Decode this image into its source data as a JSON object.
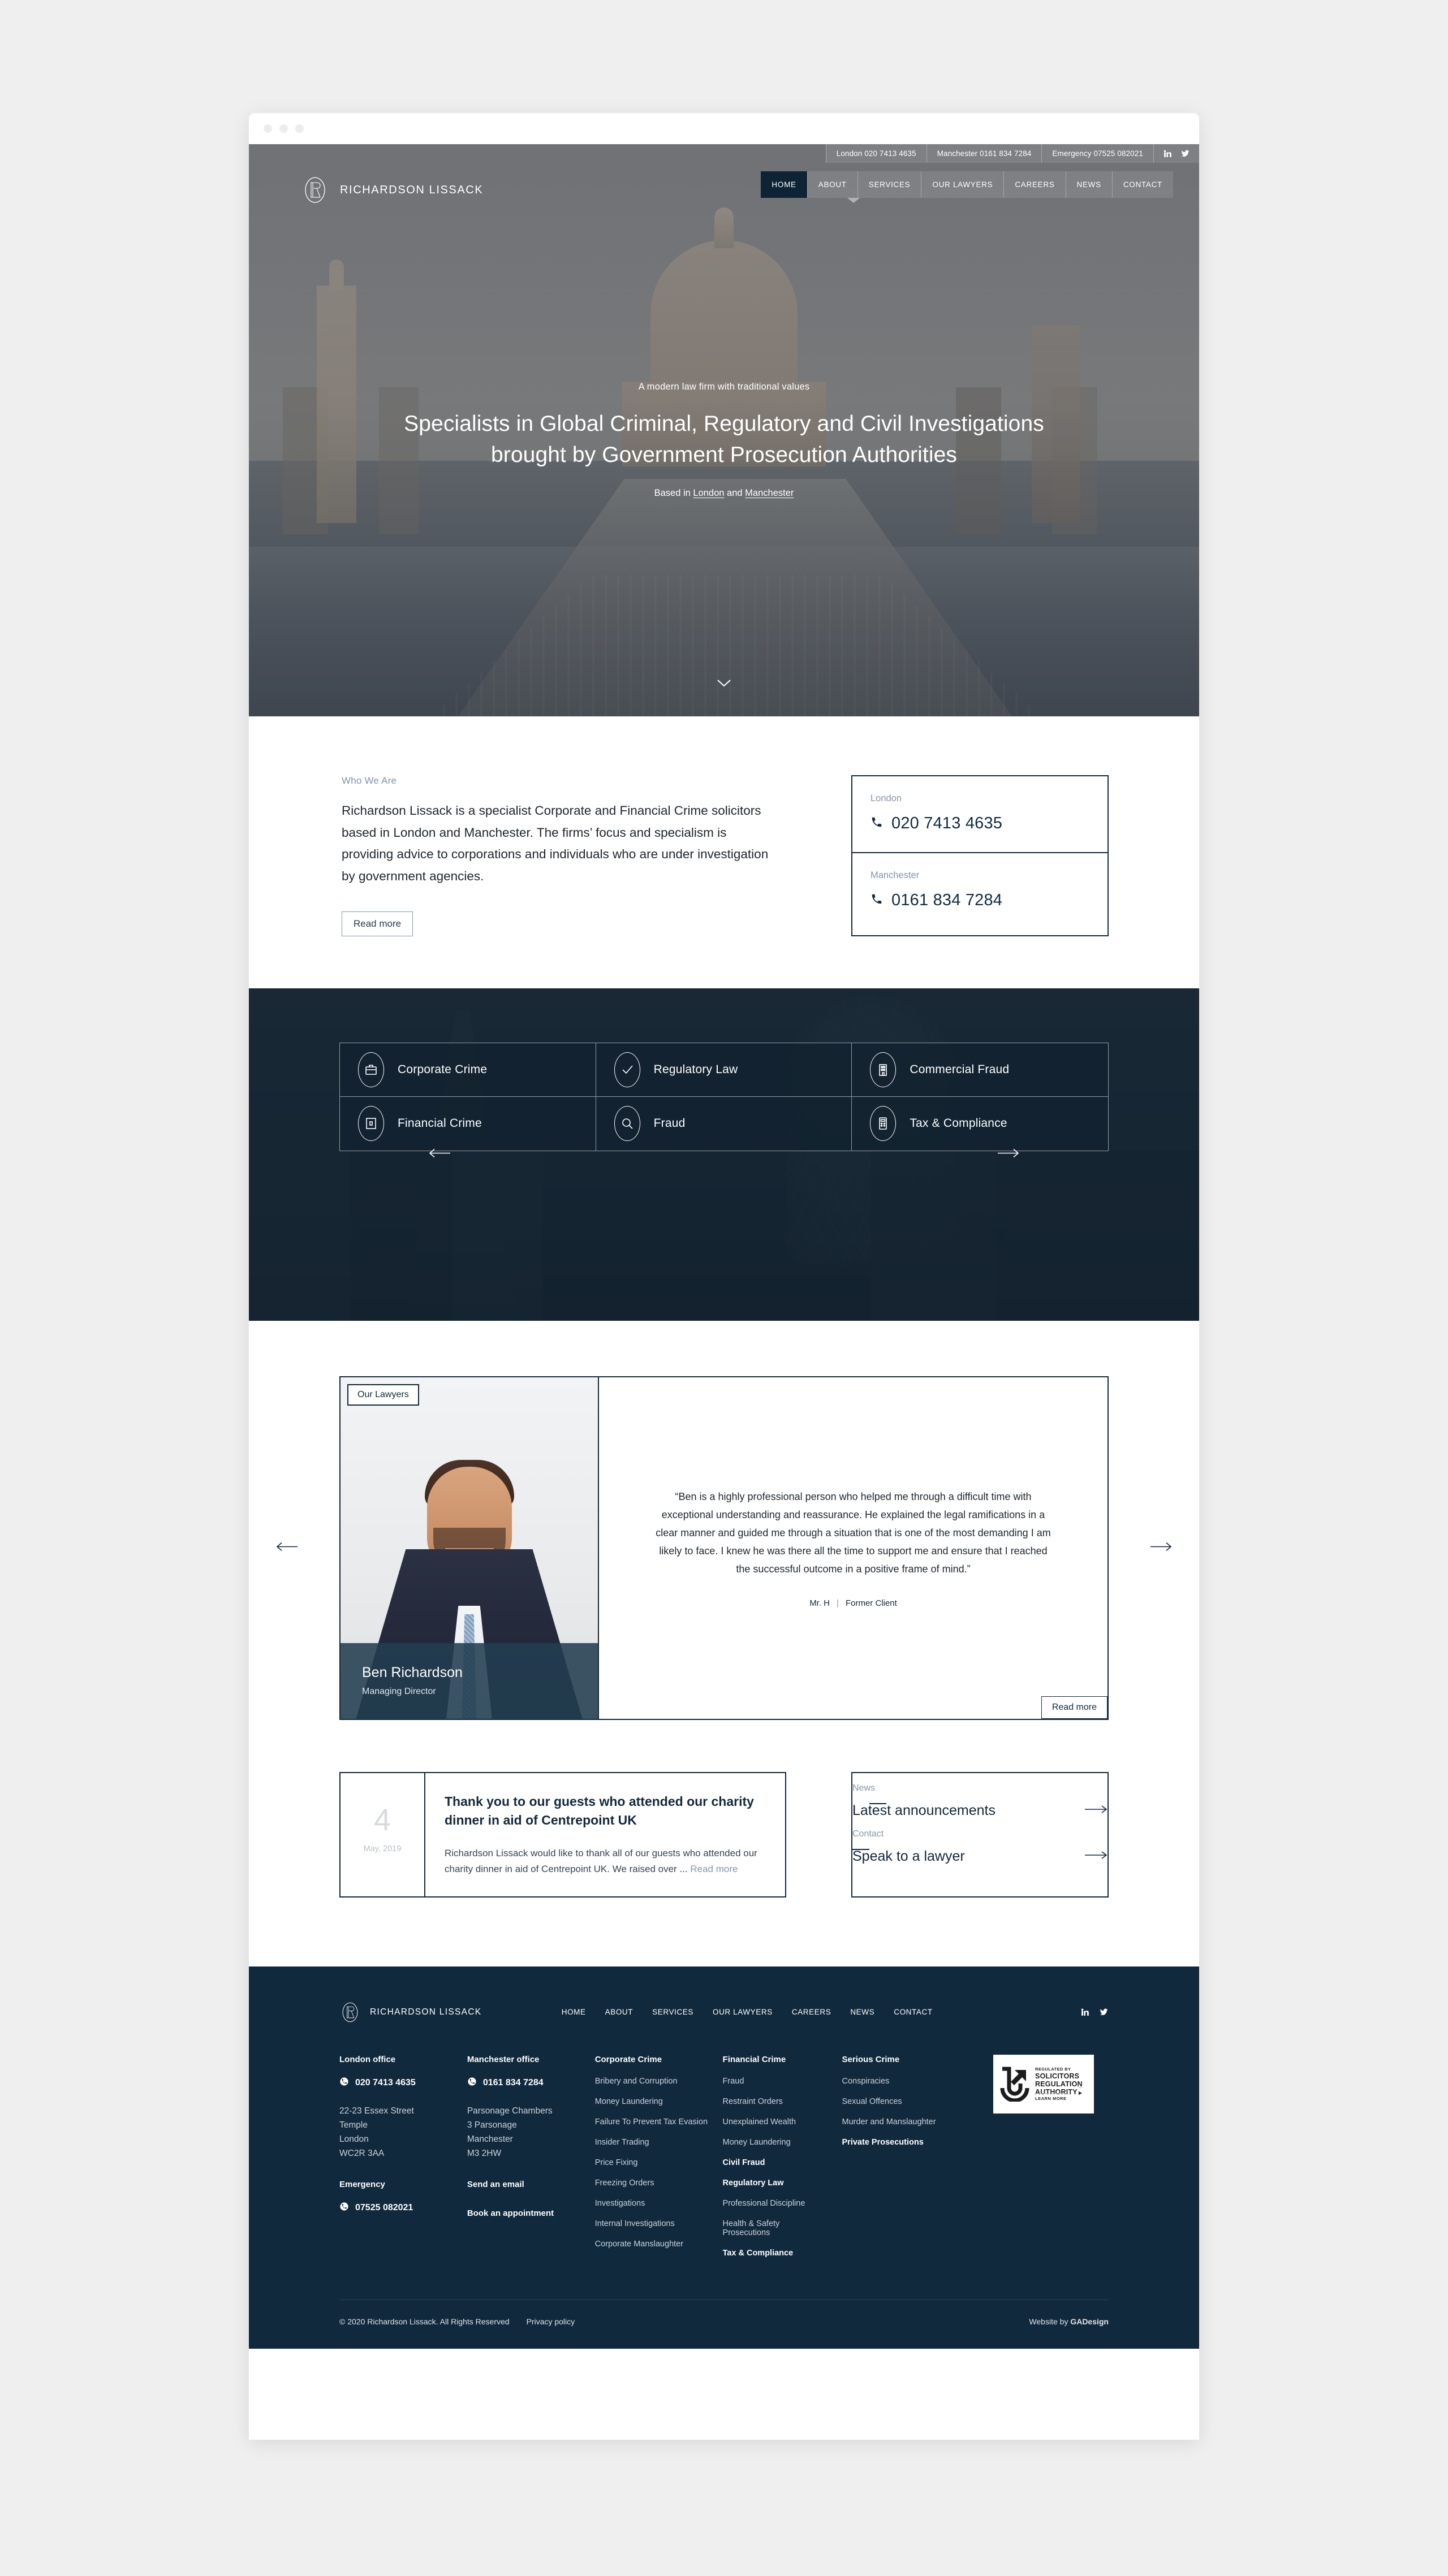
{
  "topbar": {
    "items": [
      "London 020 7413 4635",
      "Manchester 0161 834 7284",
      "Emergency 07525 082021"
    ],
    "social": [
      "linkedin-icon",
      "twitter-icon"
    ]
  },
  "brand": {
    "name": "RICHARDSON LISSACK",
    "mark": "rl-monogram-icon"
  },
  "nav": {
    "items": [
      "HOME",
      "ABOUT",
      "SERVICES",
      "OUR LAWYERS",
      "CAREERS",
      "NEWS",
      "CONTACT"
    ],
    "active": "HOME",
    "active_bg": "#0e2435"
  },
  "hero": {
    "eyebrow": "A modern law firm with traditional values",
    "title_line1": "Specialists in Global Criminal, Regulatory and Civil Investigations",
    "title_line2": "brought by Government Prosecution Authorities",
    "sub_prefix": "Based in ",
    "sub_link1": "London",
    "sub_mid": " and ",
    "sub_link2": "Manchester",
    "scroll_cue": "chevron-down-icon"
  },
  "intro": {
    "eyebrow": "Who We Are",
    "body": "Richardson Lissack is a specialist Corporate and Financial Crime solicitors based in London and Manchester. The firms’ focus and specialism is providing advice to corporations and individuals who are under investigation by government agencies.",
    "read_more": "Read more",
    "contact_cards": [
      {
        "label": "London",
        "number": "020 7413 4635",
        "icon": "phone-icon"
      },
      {
        "label": "Manchester",
        "number": "0161 834 7284",
        "icon": "phone-icon"
      }
    ]
  },
  "services": {
    "prev": "arrow-left-icon",
    "next": "arrow-right-icon",
    "items": [
      {
        "label": "Corporate Crime",
        "icon": "briefcase-icon"
      },
      {
        "label": "Regulatory Law",
        "icon": "check-icon"
      },
      {
        "label": "Commercial Fraud",
        "icon": "building-icon"
      },
      {
        "label": "Financial Crime",
        "icon": "document-icon"
      },
      {
        "label": "Fraud",
        "icon": "magnifier-icon"
      },
      {
        "label": "Tax & Compliance",
        "icon": "calculator-icon"
      }
    ]
  },
  "lawyers": {
    "tab": "Our Lawyers",
    "name": "Ben Richardson",
    "role": "Managing Director",
    "quote": "“Ben is a highly professional person who helped me through a difficult time with exceptional understanding and reassurance. He explained the legal ramifications in a clear manner and guided me through a situation that is one of the most demanding I am likely to face. I knew he was there all the time to support me and ensure that I reached the successful outcome in a positive frame of mind.”",
    "attribution_name": "Mr. H",
    "attribution_role": "Former Client",
    "read_more": "Read more",
    "prev": "arrow-left-icon",
    "next": "arrow-right-icon"
  },
  "news": {
    "card": {
      "day": "4",
      "month_year": "May, 2019",
      "title": "Thank you to our guests who attended our charity dinner in aid of Centrepoint UK",
      "excerpt": "Richardson Lissack would like to thank all of our guests who attended our charity dinner in aid of Centrepoint UK. We raised over ... ",
      "read_more": "Read more"
    },
    "ctas": [
      {
        "label": "News",
        "title": "Latest announcements",
        "icon": "arrow-right-icon"
      },
      {
        "label": "Contact",
        "title": "Speak to a lawyer",
        "icon": "arrow-right-icon"
      }
    ]
  },
  "footer": {
    "brand_name": "RICHARDSON LISSACK",
    "nav": [
      "HOME",
      "ABOUT",
      "SERVICES",
      "OUR LAWYERS",
      "CAREERS",
      "NEWS",
      "CONTACT"
    ],
    "social": [
      "linkedin-icon",
      "twitter-icon"
    ],
    "london": {
      "head": "London office",
      "phone": "020 7413 4635",
      "address": "22-23 Essex Street\nTemple\nLondon\nWC2R 3AA",
      "sub_head": "Emergency",
      "sub_phone": "07525 082021"
    },
    "manchester": {
      "head": "Manchester office",
      "phone": "0161 834 7284",
      "address": "Parsonage Chambers\n3 Parsonage\nManchester\nM3 2HW",
      "link1": "Send an email",
      "link2": "Book an appointment"
    },
    "col_corporate": {
      "head": "Corporate Crime",
      "links": [
        "Bribery and Corruption",
        "Money Laundering",
        "Failure To Prevent Tax Evasion",
        "Insider Trading",
        "Price Fixing",
        "Freezing Orders",
        "Investigations",
        "Internal Investigations",
        "Corporate Manslaughter"
      ]
    },
    "col_financial": {
      "head": "Financial Crime",
      "links": [
        "Fraud",
        "Restraint Orders",
        "Unexplained Wealth",
        "Money Laundering"
      ],
      "head2": "Civil Fraud",
      "head3": "Regulatory Law",
      "links2": [
        "Professional Discipline",
        "Health & Safety Prosecutions"
      ],
      "head4": "Tax & Compliance"
    },
    "col_serious": {
      "head": "Serious Crime",
      "links": [
        "Conspiracies",
        "Sexual Offences",
        "Murder and Manslaughter"
      ],
      "head2": "Private Prosecutions"
    },
    "sra": {
      "line1": "REGULATED BY",
      "line2": "SOLICITORS REGULATION AUTHORITY",
      "line3": "▶ LEARN MORE",
      "icon": "sra-shield-icon"
    },
    "copyright": "© 2020 Richardson Lissack. All Rights Reserved",
    "privacy": "Privacy policy",
    "credit_prefix": "Website by ",
    "credit_name": "GADesign"
  }
}
